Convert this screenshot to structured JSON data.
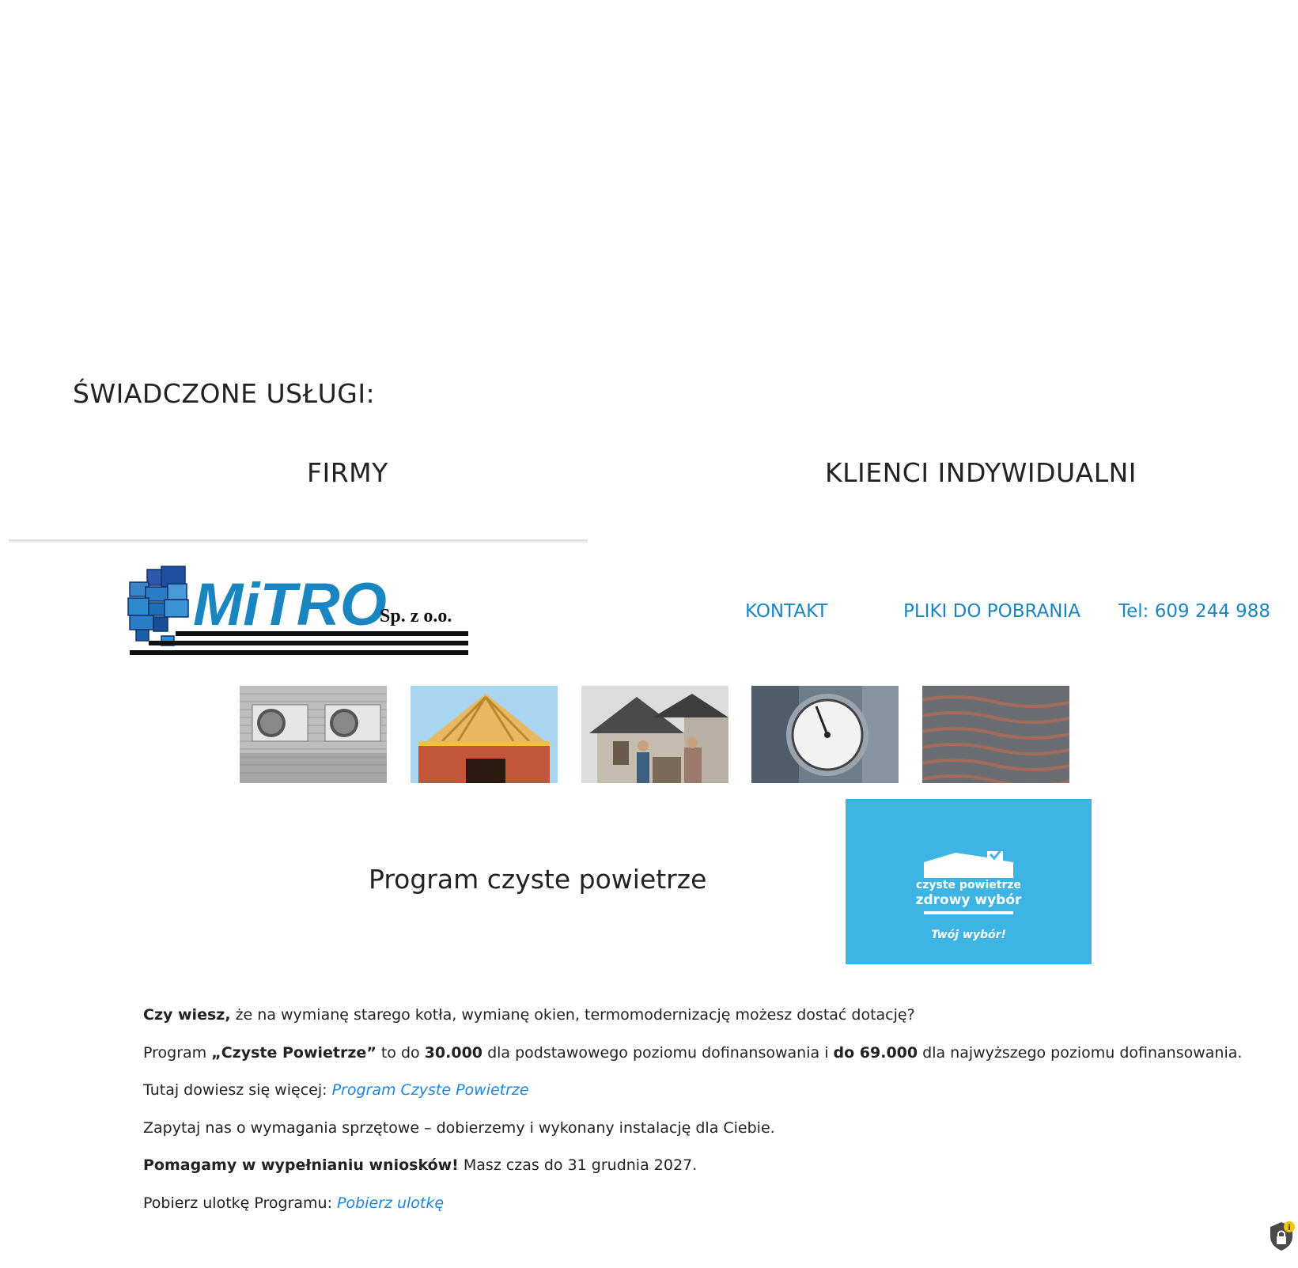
{
  "services": {
    "heading": "ŚWIADCZONE USŁUGI:",
    "tabs": [
      {
        "label": "FIRMY"
      },
      {
        "label": "KLIENCI INDYWIDUALNI"
      }
    ]
  },
  "logo": {
    "text": "MiTRO",
    "suffix": "Sp. z o.o."
  },
  "nav": {
    "kontakt": "KONTAKT",
    "pliki": "PLIKI DO POBRANIA",
    "tel": "Tel: 609 244 988"
  },
  "thumbnails": [
    {
      "icon": "air-conditioner-units-image"
    },
    {
      "icon": "roof-construction-image"
    },
    {
      "icon": "house-inspection-image"
    },
    {
      "icon": "pressure-gauge-image"
    },
    {
      "icon": "underfloor-heating-image"
    }
  ],
  "program": {
    "title": "Program czyste powietrze",
    "banner": {
      "line1": "czyste powietrze",
      "line2": "zdrowy wybór",
      "line3": "Twój wybór!",
      "color": "#3eb4e4"
    }
  },
  "content": {
    "p1_bold": "Czy wiesz,",
    "p1_rest": " że na wymianę starego kotła, wymianę okien, termomodernizację możesz dostać dotację?",
    "p2_a": "Program ",
    "p2_b": "„Czyste Powietrze”",
    "p2_c": " to do ",
    "p2_d": "30.000",
    "p2_e": " dla podstawowego poziomu dofinansowania i ",
    "p2_f": "do 69.000",
    "p2_g": " dla najwyższego poziomu dofinansowania.",
    "p3_text": "Tutaj dowiesz się więcej: ",
    "p3_link": "Program Czyste Powietrze",
    "p4_text": "Zapytaj nas o wymagania sprzętowe – dobierzemy i wykonany instalację dla Ciebie.",
    "p5_bold": "Pomagamy w wypełnianiu wniosków!",
    "p5_rest": " Masz czas do 31 grudnia 2027.",
    "p6_text": "Pobierz ulotkę Programu: ",
    "p6_link": "Pobierz ulotkę"
  },
  "colors": {
    "link": "#1a86e0",
    "nav": "#1a86c1",
    "brand_blue": "#1a86c1"
  }
}
